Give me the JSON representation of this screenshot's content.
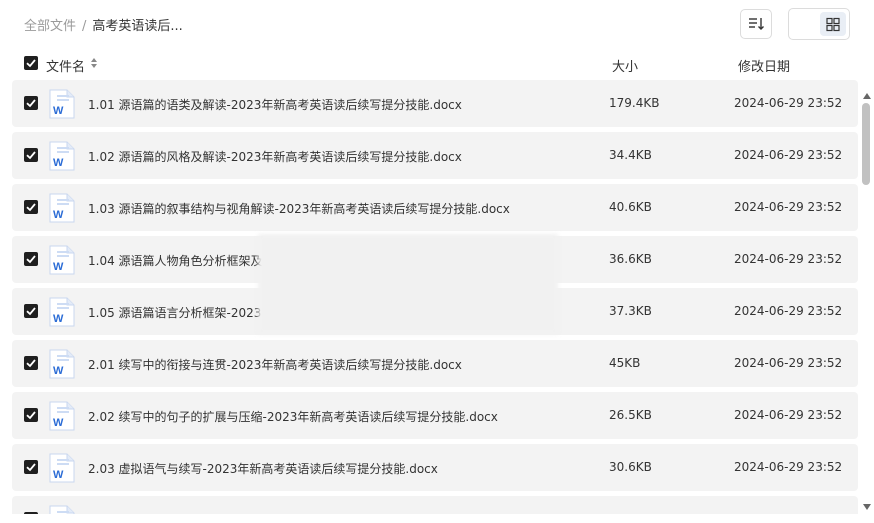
{
  "breadcrumb": {
    "root": "全部文件",
    "separator": "/",
    "current": "高考英语读后..."
  },
  "table": {
    "col_name": "文件名",
    "col_size": "大小",
    "col_date": "修改日期"
  },
  "files": [
    {
      "name": "1.01 源语篇的语类及解读-2023年新高考英语读后续写提分技能.docx",
      "size": "179.4KB",
      "date": "2024-06-29 23:52"
    },
    {
      "name": "1.02 源语篇的风格及解读-2023年新高考英语读后续写提分技能.docx",
      "size": "34.4KB",
      "date": "2024-06-29 23:52"
    },
    {
      "name": "1.03 源语篇的叙事结构与视角解读-2023年新高考英语读后续写提分技能.docx",
      "size": "40.6KB",
      "date": "2024-06-29 23:52"
    },
    {
      "name": "1.04 源语篇人物角色分析框架及",
      "size": "36.6KB",
      "date": "2024-06-29 23:52"
    },
    {
      "name": "1.05 源语篇语言分析框架-2023",
      "size": "37.3KB",
      "date": "2024-06-29 23:52"
    },
    {
      "name": "2.01 续写中的衔接与连贯-2023年新高考英语读后续写提分技能.docx",
      "size": "45KB",
      "date": "2024-06-29 23:52"
    },
    {
      "name": "2.02 续写中的句子的扩展与压缩-2023年新高考英语读后续写提分技能.docx",
      "size": "26.5KB",
      "date": "2024-06-29 23:52"
    },
    {
      "name": "2.03 虚拟语气与续写-2023年新高考英语读后续写提分技能.docx",
      "size": "30.6KB",
      "date": "2024-06-29 23:52"
    },
    {
      "name": "",
      "size": "",
      "date": ""
    }
  ],
  "icons": {
    "file": "word-doc-icon",
    "sort": "sort-icon",
    "list_view": "list-view-icon",
    "grid_view": "grid-view-icon"
  },
  "colors": {
    "word_blue": "#2b6cd6",
    "row_bg": "#f3f3f3",
    "checkbox": "#1f1f1f"
  }
}
